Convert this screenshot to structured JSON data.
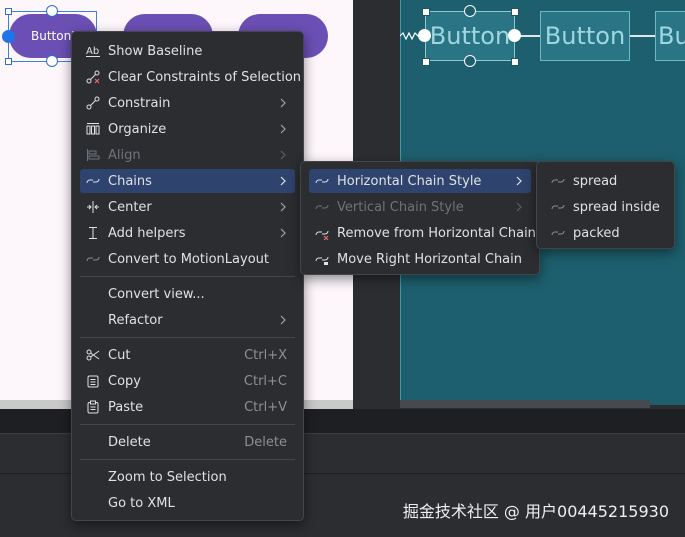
{
  "design_surface": {
    "buttons": [
      "Button'",
      "",
      ""
    ]
  },
  "blueprint": {
    "buttons": [
      "Button",
      "Button",
      "Bu"
    ]
  },
  "context_menu": {
    "items": [
      {
        "label": "Show Baseline",
        "icon": "baseline-icon",
        "enabled": true,
        "submenu": false
      },
      {
        "label": "Clear Constraints of Selection",
        "icon": "clear-constraints-icon",
        "enabled": true,
        "submenu": false
      },
      {
        "label": "Constrain",
        "icon": "constrain-icon",
        "enabled": true,
        "submenu": true
      },
      {
        "label": "Organize",
        "icon": "organize-icon",
        "enabled": true,
        "submenu": true
      },
      {
        "label": "Align",
        "icon": "align-icon",
        "enabled": false,
        "submenu": true
      },
      {
        "label": "Chains",
        "icon": "chains-icon",
        "enabled": true,
        "submenu": true,
        "active": true
      },
      {
        "label": "Center",
        "icon": "center-icon",
        "enabled": true,
        "submenu": true
      },
      {
        "label": "Add helpers",
        "icon": "add-helpers-icon",
        "enabled": true,
        "submenu": true
      },
      {
        "label": "Convert to MotionLayout",
        "icon": "motionlayout-icon",
        "enabled": true,
        "submenu": false
      },
      {
        "label": "Convert view...",
        "enabled": true,
        "submenu": false
      },
      {
        "label": "Refactor",
        "enabled": true,
        "submenu": true
      },
      {
        "label": "Cut",
        "icon": "cut-icon",
        "shortcut": "Ctrl+X",
        "enabled": true
      },
      {
        "label": "Copy",
        "icon": "copy-icon",
        "shortcut": "Ctrl+C",
        "enabled": true
      },
      {
        "label": "Paste",
        "icon": "paste-icon",
        "shortcut": "Ctrl+V",
        "enabled": true
      },
      {
        "label": "Delete",
        "shortcut": "Delete",
        "enabled": true
      },
      {
        "label": "Zoom to Selection",
        "enabled": true
      },
      {
        "label": "Go to XML",
        "enabled": true
      }
    ]
  },
  "chains_submenu": {
    "items": [
      {
        "label": "Horizontal Chain Style",
        "enabled": true,
        "submenu": true,
        "active": true
      },
      {
        "label": "Vertical Chain Style",
        "enabled": false,
        "submenu": true
      },
      {
        "label": "Remove from Horizontal Chain",
        "enabled": true
      },
      {
        "label": "Move Right Horizontal Chain",
        "enabled": true
      }
    ]
  },
  "chain_style_submenu": {
    "items": [
      {
        "label": "spread"
      },
      {
        "label": "spread inside"
      },
      {
        "label": "packed"
      }
    ]
  },
  "watermark": "掘金技术社区 @ 用户00445215930",
  "colors": {
    "menu_bg": "#2b2d30",
    "menu_active": "#2e436e",
    "design_bg": "#fdf6fb",
    "blueprint_bg": "#1d5f6e",
    "button_purple": "#6b4fb4"
  }
}
